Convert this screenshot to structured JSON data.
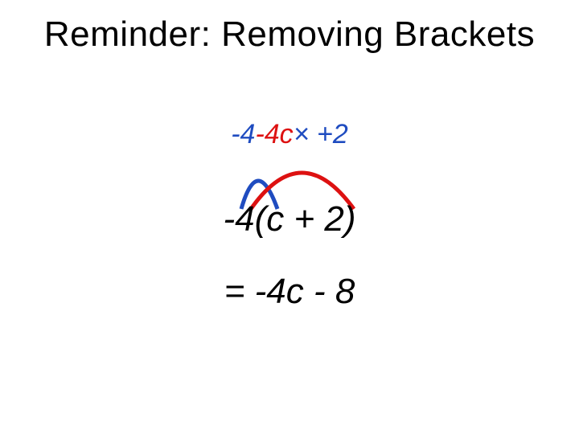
{
  "title": "Reminder: Removing Brackets",
  "annotation": {
    "part_blue_1": "-4",
    "part_red_1": "-4c",
    "part_blue_2": "× +2",
    "color_blue": "#1f4cc0",
    "color_red": "#d11"
  },
  "expression": "-4(c + 2)",
  "result": "= -4c - 8",
  "arcs": {
    "blue": "#1f4cc0",
    "red": "#d11"
  }
}
